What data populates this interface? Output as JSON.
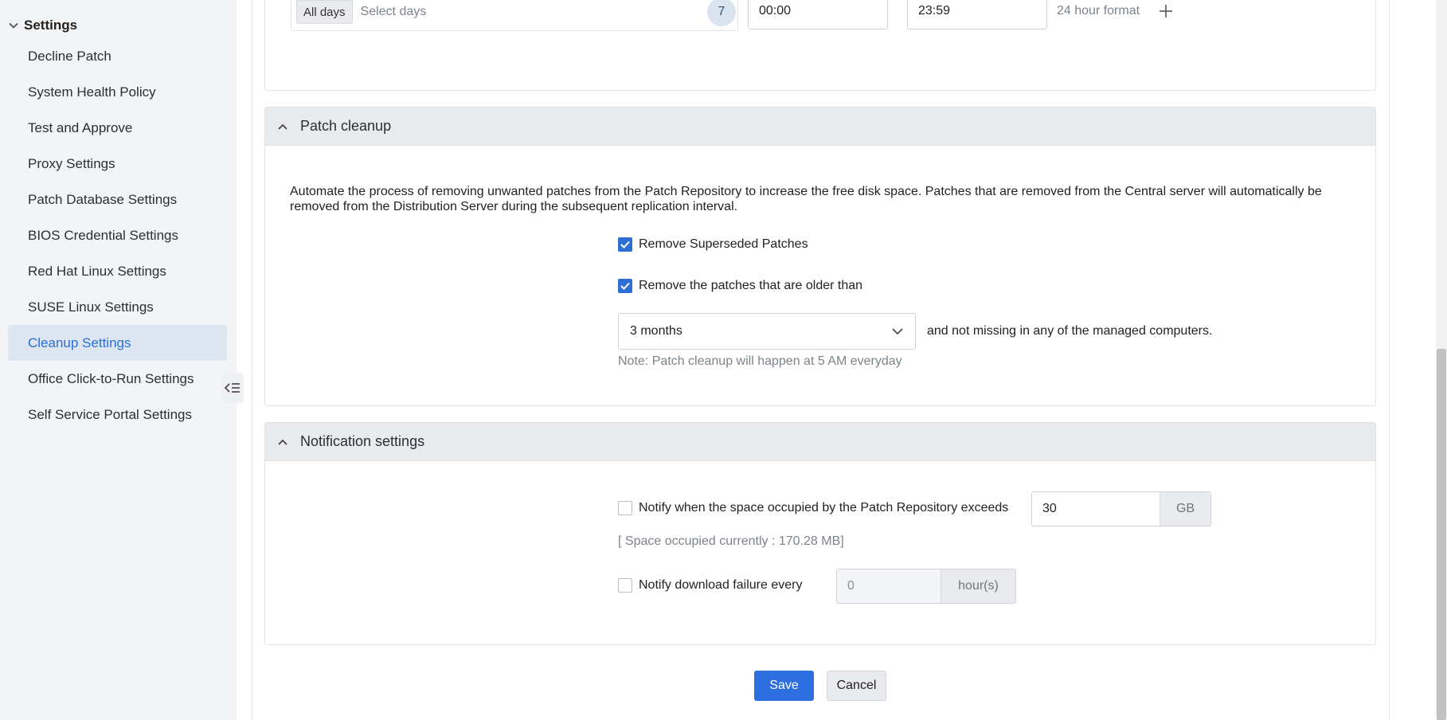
{
  "sidebar": {
    "header": "Settings",
    "items": [
      {
        "label": "Decline Patch"
      },
      {
        "label": "System Health Policy"
      },
      {
        "label": "Test and Approve"
      },
      {
        "label": "Proxy Settings"
      },
      {
        "label": "Patch Database Settings"
      },
      {
        "label": "BIOS Credential Settings"
      },
      {
        "label": "Red Hat Linux Settings"
      },
      {
        "label": "SUSE Linux Settings"
      },
      {
        "label": "Cleanup Settings"
      },
      {
        "label": "Office Click-to-Run Settings"
      },
      {
        "label": "Self Service Portal Settings"
      }
    ],
    "active_index": 8
  },
  "schedule": {
    "days_chip": "All days",
    "days_placeholder": "Select days",
    "days_count": "7",
    "start_time": "00:00",
    "end_time": "23:59",
    "format_hint": "24 hour format"
  },
  "cleanup": {
    "title": "Patch cleanup",
    "description": "Automate the process of removing unwanted patches from the Patch Repository to increase the free disk space. Patches that are removed from the Central server will automatically be removed from the Distribution Server during the subsequent replication interval.",
    "superseded_label": "Remove Superseded Patches",
    "superseded_checked": true,
    "older_label": "Remove the patches that are older than",
    "older_checked": true,
    "period_value": "3 months",
    "after_select": "and not missing in any of the managed computers.",
    "note": "Note: Patch cleanup will happen at 5 AM everyday"
  },
  "notification": {
    "title": "Notification settings",
    "space_label": "Notify when the space occupied by the Patch Repository exceeds",
    "space_checked": false,
    "space_value": "30",
    "space_unit": "GB",
    "space_info": "[ Space occupied currently : 170.28 MB]",
    "failure_label": "Notify download failure every",
    "failure_checked": false,
    "failure_value": "0",
    "failure_unit": "hour(s)"
  },
  "actions": {
    "save": "Save",
    "cancel": "Cancel"
  },
  "colors": {
    "accent": "#2d6fe0",
    "active_bg": "#dde6f0",
    "active_text": "#2a6fd6"
  }
}
